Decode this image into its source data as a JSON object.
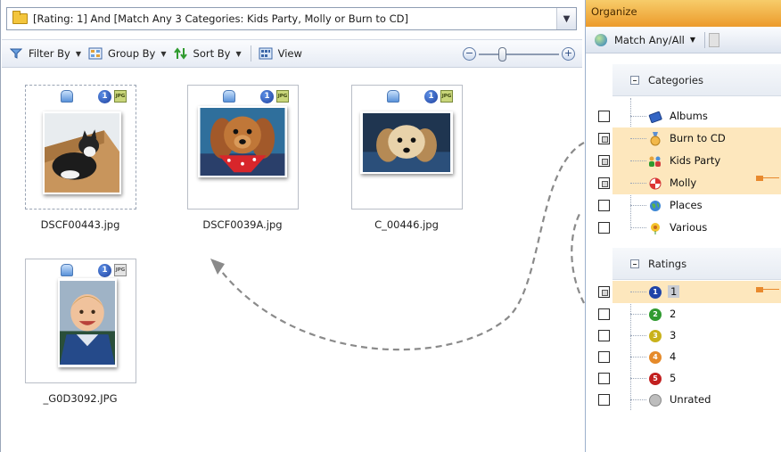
{
  "search": {
    "query": "[Rating: 1] And [Match Any 3 Categories: Kids Party, Molly or Burn to CD]",
    "dropdown_glyph": "▼"
  },
  "toolbar": {
    "filter_label": "Filter By",
    "group_label": "Group By",
    "sort_label": "Sort By",
    "view_label": "View",
    "caret": "▼",
    "zoom_minus": "−",
    "zoom_plus": "+"
  },
  "thumbnails": [
    {
      "filename": "DSCF00443.jpg",
      "rating": "1",
      "format": "JPG"
    },
    {
      "filename": "DSCF0039A.jpg",
      "rating": "1",
      "format": "JPG"
    },
    {
      "filename": "C_00446.jpg",
      "rating": "1",
      "format": "JPG"
    },
    {
      "filename": "_G0D3092.JPG",
      "rating": "1",
      "format": "JPG"
    }
  ],
  "organize": {
    "header": "Organize",
    "match_label": "Match Any/All",
    "caret": "▼",
    "categories_header": "Categories",
    "categories": [
      {
        "label": "Albums",
        "checked": false,
        "highlighted": false
      },
      {
        "label": "Burn to CD",
        "checked": true,
        "highlighted": true
      },
      {
        "label": "Kids Party",
        "checked": true,
        "highlighted": true
      },
      {
        "label": "Molly",
        "checked": true,
        "highlighted": true
      },
      {
        "label": "Places",
        "checked": false,
        "highlighted": false
      },
      {
        "label": "Various",
        "checked": false,
        "highlighted": false
      }
    ],
    "ratings_header": "Ratings",
    "ratings": [
      {
        "label": "1",
        "badge": "1",
        "color": "#1f44a8",
        "checked": true,
        "highlighted": true
      },
      {
        "label": "2",
        "badge": "2",
        "color": "#2f9a2f",
        "checked": false,
        "highlighted": false
      },
      {
        "label": "3",
        "badge": "3",
        "color": "#c9b21c",
        "checked": false,
        "highlighted": false
      },
      {
        "label": "4",
        "badge": "4",
        "color": "#e58a2a",
        "checked": false,
        "highlighted": false
      },
      {
        "label": "5",
        "badge": "5",
        "color": "#c22020",
        "checked": false,
        "highlighted": false
      },
      {
        "label": "Unrated",
        "badge": "",
        "color": "#bdbdbd",
        "checked": false,
        "highlighted": false
      }
    ]
  },
  "colors": {
    "header_orange": "#ec9b2b",
    "highlight": "#fde7bd",
    "marker": "#e8892d"
  }
}
